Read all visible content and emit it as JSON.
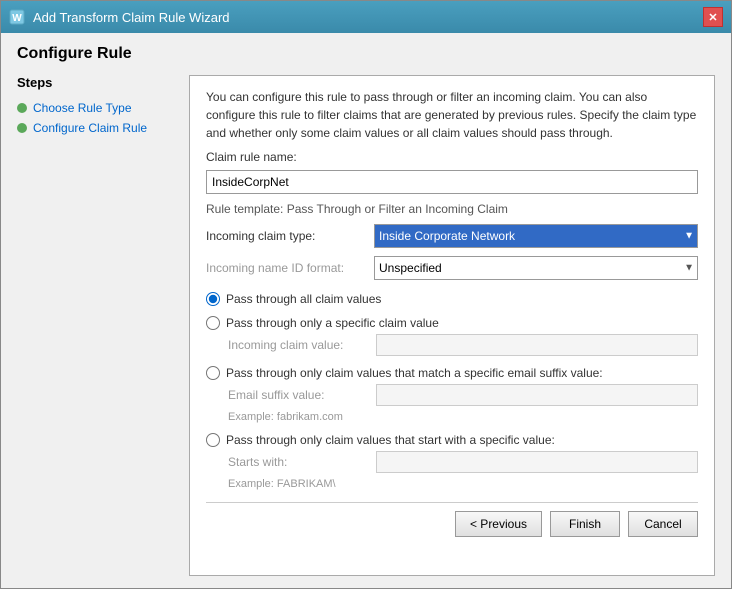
{
  "window": {
    "title": "Add Transform Claim Rule Wizard",
    "close_label": "✕",
    "icon": "⚙"
  },
  "page": {
    "heading": "Configure Rule"
  },
  "sidebar": {
    "heading": "Steps",
    "items": [
      {
        "id": "choose-rule-type",
        "label": "Choose Rule Type",
        "active": true
      },
      {
        "id": "configure-claim-rule",
        "label": "Configure Claim Rule",
        "active": true
      }
    ]
  },
  "description": "You can configure this rule to pass through or filter an incoming claim. You can also configure this rule to filter claims that are generated by previous rules. Specify the claim type and whether only some claim values or all claim values should pass through.",
  "form": {
    "claim_rule_name_label": "Claim rule name:",
    "claim_rule_name_value": "InsideCorpNet",
    "rule_template_label": "Rule template: Pass Through or Filter an Incoming Claim",
    "incoming_claim_type_label": "Incoming claim type:",
    "incoming_claim_type_value": "Inside Corporate Network",
    "incoming_name_id_format_label": "Incoming name ID format:",
    "incoming_name_id_format_value": "Unspecified",
    "radio_options": [
      {
        "id": "pass-all",
        "label": "Pass through all claim values",
        "checked": true,
        "sub_fields": []
      },
      {
        "id": "pass-specific",
        "label": "Pass through only a specific claim value",
        "checked": false,
        "sub_fields": [
          {
            "label": "Incoming claim value:",
            "placeholder": "",
            "example": ""
          }
        ]
      },
      {
        "id": "pass-email-suffix",
        "label": "Pass through only claim values that match a specific email suffix value:",
        "checked": false,
        "sub_fields": [
          {
            "label": "Email suffix value:",
            "placeholder": "",
            "example": "Example: fabrikam.com"
          }
        ]
      },
      {
        "id": "pass-starts-with",
        "label": "Pass through only claim values that start with a specific value:",
        "checked": false,
        "sub_fields": [
          {
            "label": "Starts with:",
            "placeholder": "",
            "example": "Example: FABRIKAM\\"
          }
        ]
      }
    ]
  },
  "footer": {
    "previous_label": "< Previous",
    "finish_label": "Finish",
    "cancel_label": "Cancel"
  }
}
